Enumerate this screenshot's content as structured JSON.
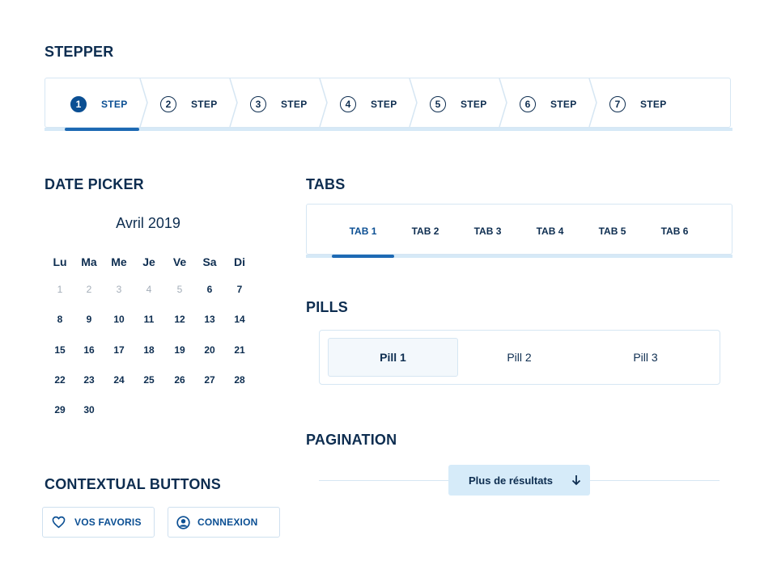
{
  "sections": {
    "stepper": "STEPPER",
    "date_picker": "DATE PICKER",
    "tabs": "TABS",
    "pills": "PILLS",
    "pagination": "PAGINATION",
    "contextual_buttons": "CONTEXTUAL BUTTONS"
  },
  "stepper": {
    "active_step": 1,
    "steps": [
      {
        "num": "1",
        "label": "STEP"
      },
      {
        "num": "2",
        "label": "STEP"
      },
      {
        "num": "3",
        "label": "STEP"
      },
      {
        "num": "4",
        "label": "STEP"
      },
      {
        "num": "5",
        "label": "STEP"
      },
      {
        "num": "6",
        "label": "STEP"
      },
      {
        "num": "7",
        "label": "STEP"
      }
    ]
  },
  "calendar": {
    "month_title": "Avril 2019",
    "weekdays": [
      "Lu",
      "Ma",
      "Me",
      "Je",
      "Ve",
      "Sa",
      "Di"
    ],
    "weeks": [
      [
        "1",
        "2",
        "3",
        "4",
        "5",
        "6",
        "7"
      ],
      [
        "8",
        "9",
        "10",
        "11",
        "12",
        "13",
        "14"
      ],
      [
        "15",
        "16",
        "17",
        "18",
        "19",
        "20",
        "21"
      ],
      [
        "22",
        "23",
        "24",
        "25",
        "26",
        "27",
        "28"
      ],
      [
        "29",
        "30"
      ]
    ],
    "disabled_days": [
      "1",
      "2",
      "3",
      "4",
      "5"
    ]
  },
  "tabs": {
    "active": "TAB 1",
    "items": [
      "TAB 1",
      "TAB 2",
      "TAB 3",
      "TAB 4",
      "TAB 5",
      "TAB 6"
    ]
  },
  "pills": {
    "active": "Pill 1",
    "items": [
      "Pill 1",
      "Pill 2",
      "Pill 3"
    ]
  },
  "pagination": {
    "more_label": "Plus de résultats",
    "icon": "arrow-down-icon"
  },
  "contextual": {
    "favorites_label": "VOS FAVORIS",
    "favorites_icon": "heart-icon",
    "login_label": "CONNEXION",
    "login_icon": "user-circle-icon"
  },
  "colors": {
    "primary": "#0b4f93",
    "accent_bar": "#1d69b3",
    "text": "#0d2d50",
    "muted": "#a3adb8",
    "border": "#d6e6f3",
    "button_bg": "#d6ebf9"
  }
}
